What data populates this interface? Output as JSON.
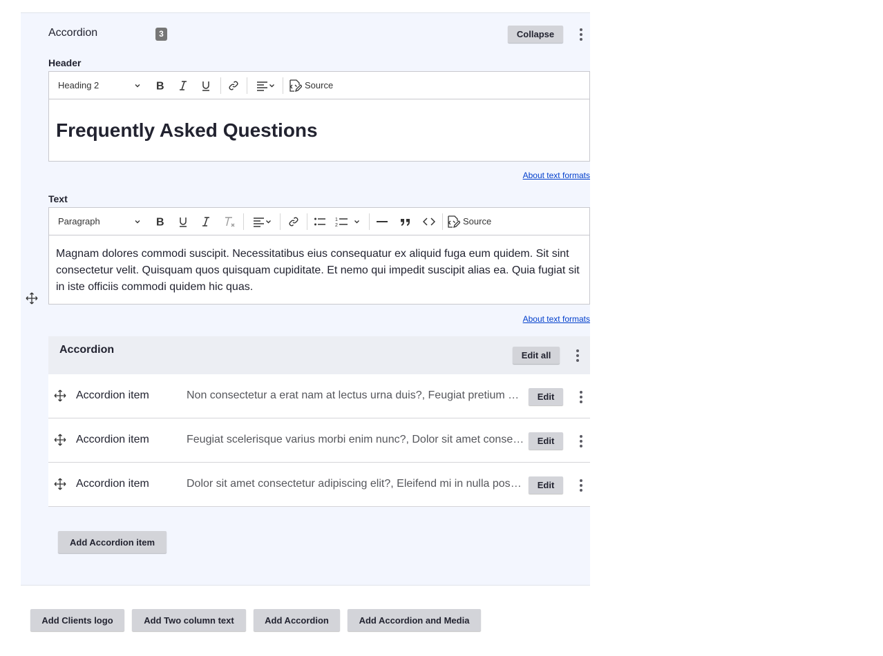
{
  "paragraph": {
    "title": "Accordion",
    "count": "3",
    "collapse_label": "Collapse"
  },
  "header_field": {
    "label": "Header",
    "format_select": "Heading 2",
    "source_label": "Source",
    "content": "Frequently Asked Questions",
    "about_link": "About text formats"
  },
  "text_field": {
    "label": "Text",
    "format_select": "Paragraph",
    "source_label": "Source",
    "content": "Magnam dolores commodi suscipit. Necessitatibus eius consequatur ex aliquid fuga eum quidem. Sit sint consectetur velit. Quisquam quos quisquam cupiditate. Et nemo qui impedit suscipit alias ea. Quia fugiat sit in iste officiis commodi quidem hic quas.",
    "about_link": "About text formats"
  },
  "accordion": {
    "title": "Accordion",
    "edit_all_label": "Edit all",
    "items": [
      {
        "label": "Accordion item",
        "summary": "Non consectetur a erat nam at lectus urna duis?, Feugiat pretium nibh ipsum consequat nisl vel pretium lectus quam",
        "edit_label": "Edit"
      },
      {
        "label": "Accordion item",
        "summary": "Feugiat scelerisque varius morbi enim nunc?, Dolor sit amet consectetur adipiscing elit pellentesque habitant",
        "edit_label": "Edit"
      },
      {
        "label": "Accordion item",
        "summary": "Dolor sit amet consectetur adipiscing elit?, Eleifend mi in nulla posuere sollicitudin aliquam ultrices",
        "edit_label": "Edit"
      }
    ],
    "add_item_label": "Add Accordion item"
  },
  "add_buttons": {
    "clients_logo": "Add Clients logo",
    "two_column_text": "Add Two column text",
    "accordion": "Add Accordion",
    "accordion_and_media": "Add Accordion and Media"
  }
}
